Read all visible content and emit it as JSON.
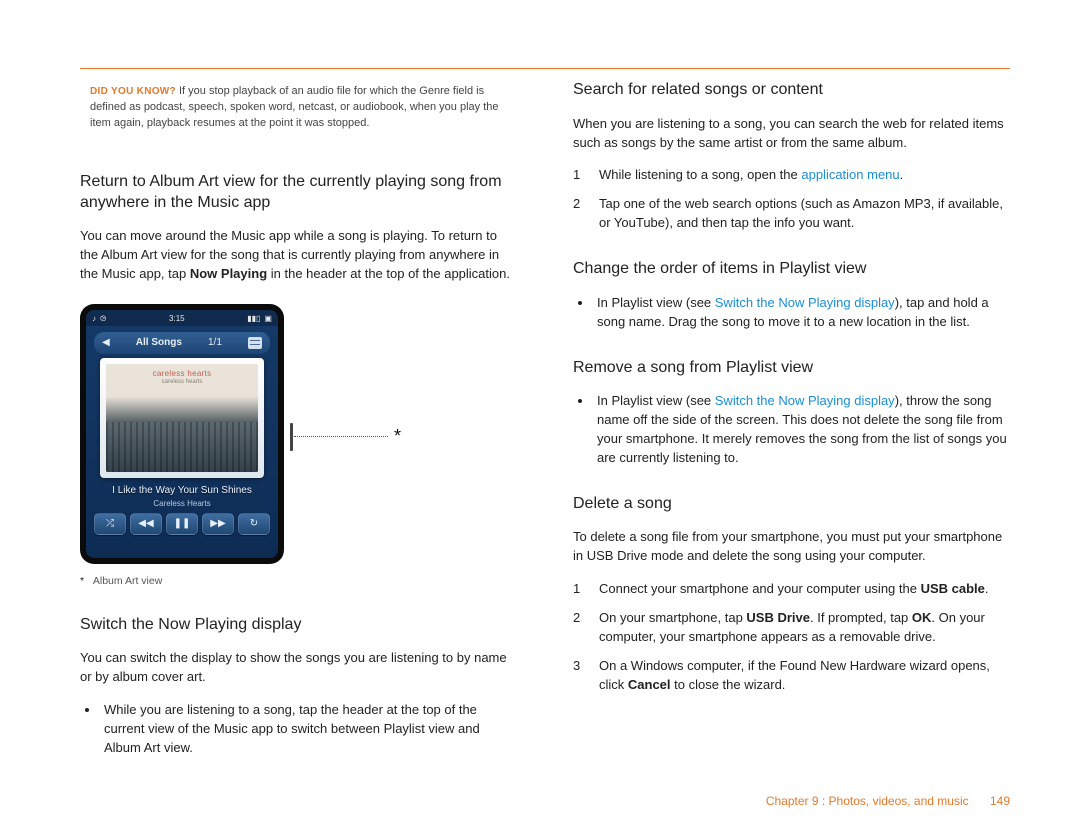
{
  "dyk": {
    "label": "DID YOU KNOW?",
    "text": "If you stop playback of an audio file for which the Genre field is defined as podcast, speech, spoken word, netcast, or audiobook, when you play the item again, playback resumes at the point it was stopped."
  },
  "left": {
    "h_return": "Return to Album Art view for the currently playing song from anywhere in the Music app",
    "p_return_pre": "You can move around the Music app while a song is playing. To return to the Album Art view for the song that is currently playing from anywhere in the Music app, tap ",
    "p_return_bold": "Now Playing",
    "p_return_post": " in the header at the top of the application.",
    "phone": {
      "time": "3:15",
      "header_title": "All Songs",
      "header_count": "1/1",
      "band": "careless hearts",
      "album_sub": "careless hearts",
      "song": "I Like the Way Your Sun Shines",
      "artist": "Careless Hearts",
      "shuffle": "⤮",
      "prev": "◀◀",
      "pause": "❚❚",
      "next": "▶▶",
      "repeat": "↻"
    },
    "callout_star": "*",
    "caption_star": "*",
    "caption_text": "Album Art view",
    "h_switch": "Switch the Now Playing display",
    "p_switch": "You can switch the display to show the songs you are listening to by name or by album cover art.",
    "bullet_switch": "While you are listening to a song, tap the header at the top of the current view of the Music app to switch between Playlist view and Album Art view."
  },
  "right": {
    "h_search": "Search for related songs or content",
    "p_search": "When you are listening to a song, you can search the web for related items such as songs by the same artist or from the same album.",
    "search_steps": [
      {
        "num": "1",
        "pre": "While listening to a song, open the ",
        "link": "application menu",
        "post": "."
      },
      {
        "num": "2",
        "pre": "Tap one of the web search options (such as Amazon MP3, if available, or YouTube), and then tap the info you want.",
        "link": "",
        "post": ""
      }
    ],
    "h_change": "Change the order of items in Playlist view",
    "change_bullet_pre": "In Playlist view (see ",
    "change_bullet_link": "Switch the Now Playing display",
    "change_bullet_post": "), tap and hold a song name. Drag the song to move it to a new location in the list.",
    "h_remove": "Remove a song from Playlist view",
    "remove_bullet_pre": "In Playlist view (see ",
    "remove_bullet_link": "Switch the Now Playing display",
    "remove_bullet_post": "), throw the song name off the side of the screen. This does not delete the song file from your smartphone. It merely removes the song from the list of songs you are currently listening to.",
    "h_delete": "Delete a song",
    "p_delete": "To delete a song file from your smartphone, you must put your smartphone in USB Drive mode and delete the song using your computer.",
    "delete_steps": {
      "s1_num": "1",
      "s1_pre": "Connect your smartphone and your computer using the ",
      "s1_b": "USB cable",
      "s1_post": ".",
      "s2_num": "2",
      "s2_pre": "On your smartphone, tap ",
      "s2_b1": "USB Drive",
      "s2_mid": ". If prompted, tap ",
      "s2_b2": "OK",
      "s2_post": ". On your computer, your smartphone appears as a removable drive.",
      "s3_num": "3",
      "s3_pre": "On a Windows computer, if the Found New Hardware wizard opens, click ",
      "s3_b": "Cancel",
      "s3_post": " to close the wizard."
    }
  },
  "footer": {
    "chapter": "Chapter 9 : Photos, videos, and music",
    "page": "149"
  }
}
